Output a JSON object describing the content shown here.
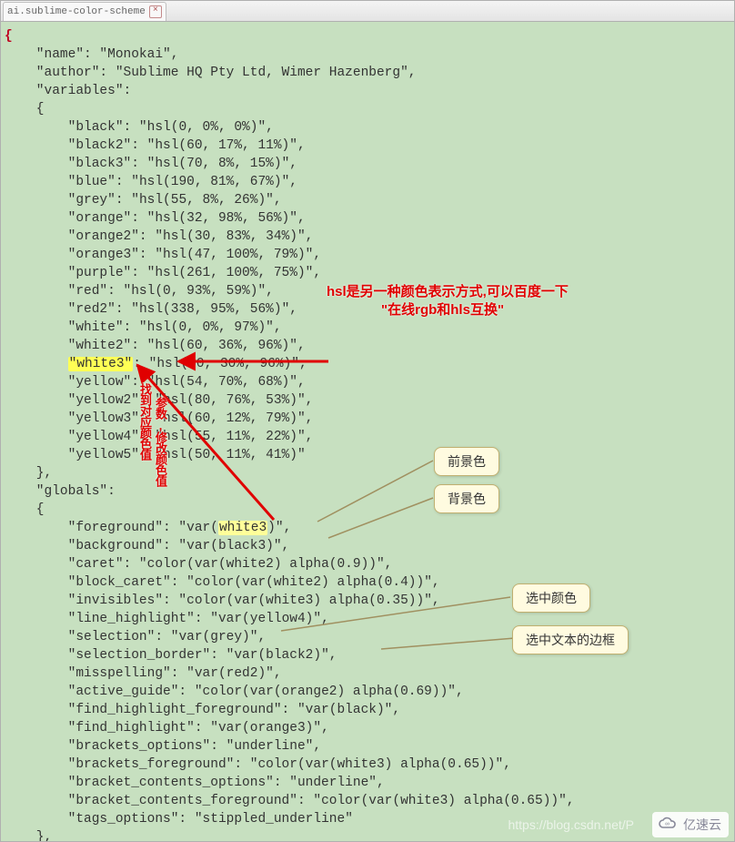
{
  "tab": {
    "filename": "ai.sublime-color-scheme"
  },
  "annotations": {
    "red_main_line1": "hsl是另一种颜色表示方式,可以百度一下",
    "red_main_line2": "\"在线rgb和hls互换\"",
    "vert1": "找到对应颜色值",
    "vert2": "参数,修改颜色值",
    "bubble_fg": "前景色",
    "bubble_bg": "背景色",
    "bubble_sel": "选中颜色",
    "bubble_selborder": "选中文本的边框"
  },
  "watermark1": "https://blog.csdn.net/P",
  "watermark2": "亿速云",
  "code": {
    "name": "Monokai",
    "author": "Sublime HQ Pty Ltd, Wimer Hazenberg",
    "variables": {
      "black": "hsl(0, 0%, 0%)",
      "black2": "hsl(60, 17%, 11%)",
      "black3": "hsl(70, 8%, 15%)",
      "blue": "hsl(190, 81%, 67%)",
      "grey": "hsl(55, 8%, 26%)",
      "orange": "hsl(32, 98%, 56%)",
      "orange2": "hsl(30, 83%, 34%)",
      "orange3": "hsl(47, 100%, 79%)",
      "purple": "hsl(261, 100%, 75%)",
      "red": "hsl(0, 93%, 59%)",
      "red2": "hsl(338, 95%, 56%)",
      "white": "hsl(0, 0%, 97%)",
      "white2": "hsl(60, 36%, 96%)",
      "white3": "hsl(60, 30%, 96%)",
      "yellow": "hsl(54, 70%, 68%)",
      "yellow2": "hsl(80, 76%, 53%)",
      "yellow3": "hsl(60, 12%, 79%)",
      "yellow4": "hsl(55, 11%, 22%)",
      "yellow5": "hsl(50, 11%, 41%)"
    },
    "globals": {
      "foreground": "var(white3)",
      "background": "var(black3)",
      "caret": "color(var(white2) alpha(0.9))",
      "block_caret": "color(var(white2) alpha(0.4))",
      "invisibles": "color(var(white3) alpha(0.35))",
      "line_highlight": "var(yellow4)",
      "selection": "var(grey)",
      "selection_border": "var(black2)",
      "misspelling": "var(red2)",
      "active_guide": "color(var(orange2) alpha(0.69))",
      "find_highlight_foreground": "var(black)",
      "find_highlight": "var(orange3)",
      "brackets_options": "underline",
      "brackets_foreground": "color(var(white3) alpha(0.65))",
      "bracket_contents_options": "underline",
      "bracket_contents_foreground": "color(var(white3) alpha(0.65))",
      "tags_options": "stippled_underline"
    }
  }
}
